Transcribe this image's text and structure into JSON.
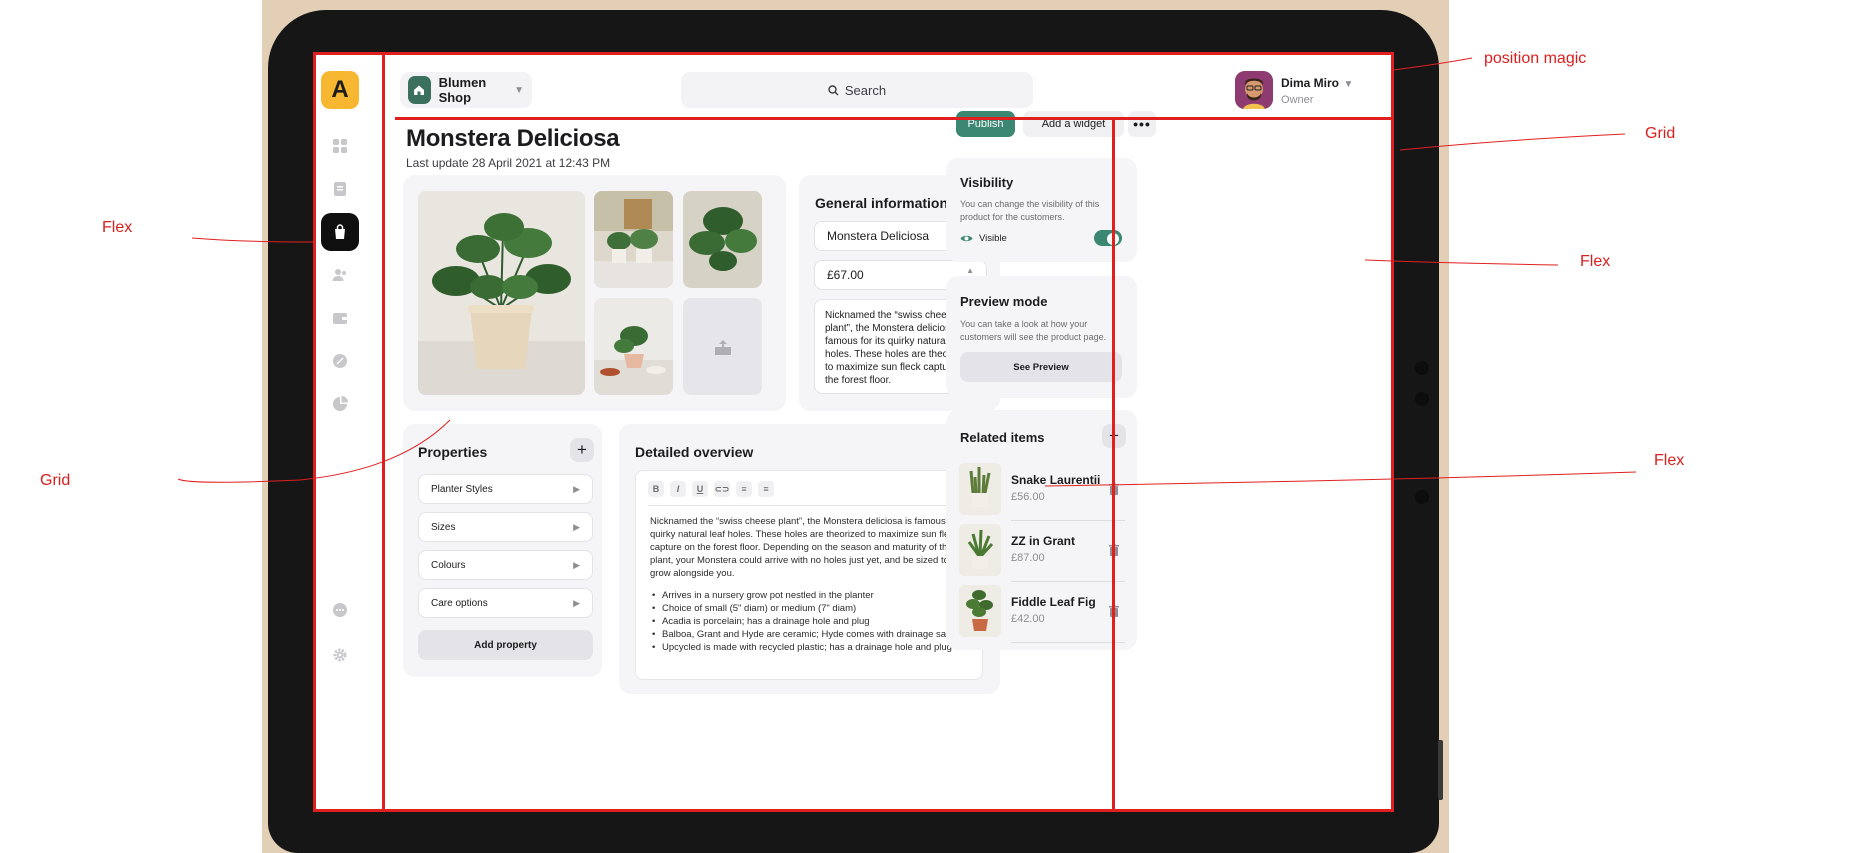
{
  "shop": {
    "name": "Blumen Shop"
  },
  "search": {
    "label": "Search"
  },
  "user": {
    "name": "Dima Miro",
    "role": "Owner"
  },
  "logo": {
    "glyph": "A"
  },
  "sidebar": {
    "items": [
      {
        "icon": "dashboard-icon",
        "active": false
      },
      {
        "icon": "document-icon",
        "active": false
      },
      {
        "icon": "shopping-bag-icon",
        "active": true
      },
      {
        "icon": "users-icon",
        "active": false
      },
      {
        "icon": "wallet-icon",
        "active": false
      },
      {
        "icon": "discount-badge-icon",
        "active": false
      },
      {
        "icon": "pie-chart-icon",
        "active": false
      }
    ],
    "bottom": [
      {
        "icon": "chat-icon"
      },
      {
        "icon": "settings-gear-icon"
      }
    ]
  },
  "page": {
    "title": "Monstera Deliciosa",
    "subtitle": "Last update 28 April 2021 at 12:43 PM"
  },
  "general": {
    "title": "General information",
    "name_value": "Monstera Deliciosa",
    "price_value": "£67.00",
    "description": "Nicknamed the “swiss cheese plant”, the Monstera deliciosa is famous for its quirky natural leaf holes. These holes are theorized to maximize sun fleck capture on the forest floor."
  },
  "properties": {
    "title": "Properties",
    "items": [
      "Planter Styles",
      "Sizes",
      "Colours",
      "Care options"
    ],
    "add_label": "Add property"
  },
  "overview": {
    "title": "Detailed overview",
    "toolbar": [
      "B",
      "I",
      "U"
    ],
    "body": "Nicknamed the “swiss cheese plant”, the Monstera deliciosa is famous for its quirky natural leaf holes. These holes are theorized to maximize sun fleck capture on the forest floor. Depending on the season and maturity of the plant, your Monstera could arrive with no holes just yet, and be sized to grow alongside you.",
    "bullets": [
      "Arrives in a nursery grow pot nestled in the planter",
      "Choice of small (5\" diam) or medium (7\" diam)",
      "Acadia is porcelain; has a drainage hole and plug",
      "Balboa, Grant and Hyde are ceramic; Hyde comes with drainage saucer",
      "Upcycled is made with recycled plastic; has a drainage hole and plug"
    ]
  },
  "actions": {
    "publish_label": "Publish",
    "widget_label": "Add a widget",
    "more_label": "•••"
  },
  "visibility": {
    "title": "Visibility",
    "description": "You can change the visibility of this product for the customers.",
    "state_label": "Visible",
    "enabled": true
  },
  "preview": {
    "title": "Preview mode",
    "description": "You can take a look at how your customers will see the product page.",
    "button_label": "See Preview"
  },
  "related": {
    "title": "Related items",
    "items": [
      {
        "name": "Snake Laurentii",
        "price": "£56.00"
      },
      {
        "name": "ZZ in Grant",
        "price": "£87.00"
      },
      {
        "name": "Fiddle Leaf Fig",
        "price": "£42.00"
      }
    ]
  },
  "annotations": {
    "position_magic": "position magic",
    "grid_top_right": "Grid",
    "flex_left": "Flex",
    "flex_right_top": "Flex",
    "grid_left": "Grid",
    "flex_right_bottom": "Flex"
  },
  "colors": {
    "accent": "#3b8772",
    "logo": "#f7b731",
    "annotation": "#e0201f",
    "card": "#f5f5f7"
  }
}
